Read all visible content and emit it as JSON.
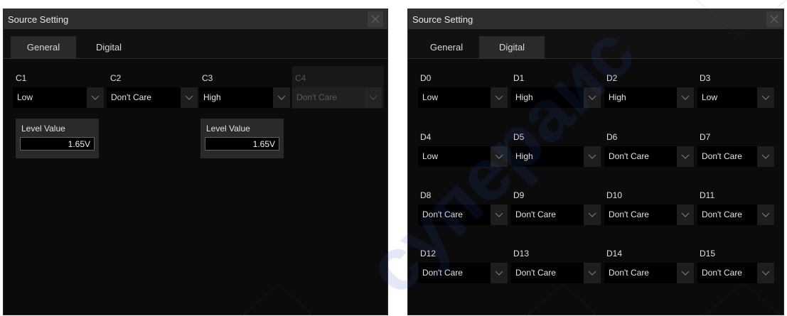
{
  "left_window": {
    "title": "Source Setting",
    "tabs": [
      {
        "label": "General"
      },
      {
        "label": "Digital"
      }
    ],
    "active_tab": "General",
    "channels": [
      {
        "label": "C1",
        "value": "Low",
        "enabled": true
      },
      {
        "label": "C2",
        "value": "Don't Care",
        "enabled": true
      },
      {
        "label": "C3",
        "value": "High",
        "enabled": true
      },
      {
        "label": "C4",
        "value": "Don't Care",
        "enabled": false
      }
    ],
    "levels": [
      {
        "label": "Level Value",
        "value": "1.65V"
      },
      {
        "label": "Level Value",
        "value": "1.65V"
      }
    ]
  },
  "right_window": {
    "title": "Source Setting",
    "tabs": [
      {
        "label": "General"
      },
      {
        "label": "Digital"
      }
    ],
    "active_tab": "Digital",
    "channels": [
      {
        "label": "D0",
        "value": "Low"
      },
      {
        "label": "D1",
        "value": "High"
      },
      {
        "label": "D2",
        "value": "High"
      },
      {
        "label": "D3",
        "value": "Low"
      },
      {
        "label": "D4",
        "value": "Low"
      },
      {
        "label": "D5",
        "value": "High"
      },
      {
        "label": "D6",
        "value": "Don't Care"
      },
      {
        "label": "D7",
        "value": "Don't Care"
      },
      {
        "label": "D8",
        "value": "Don't Care"
      },
      {
        "label": "D9",
        "value": "Don't Care"
      },
      {
        "label": "D10",
        "value": "Don't Care"
      },
      {
        "label": "D11",
        "value": "Don't Care"
      },
      {
        "label": "D12",
        "value": "Don't Care"
      },
      {
        "label": "D13",
        "value": "Don't Care"
      },
      {
        "label": "D14",
        "value": "Don't Care"
      },
      {
        "label": "D15",
        "value": "Don't Care"
      }
    ]
  },
  "icons": {
    "close": "close-icon",
    "dropdown": "chevron-down-icon"
  },
  "colors": {
    "panel_bg": "#0b0b0b",
    "titlebar_bg": "#2e2e2e",
    "active_tab_bg": "#2a2a2a",
    "dropdown_bg": "#000000",
    "watermark": "#2d52c0"
  },
  "watermark_text": "супераис"
}
